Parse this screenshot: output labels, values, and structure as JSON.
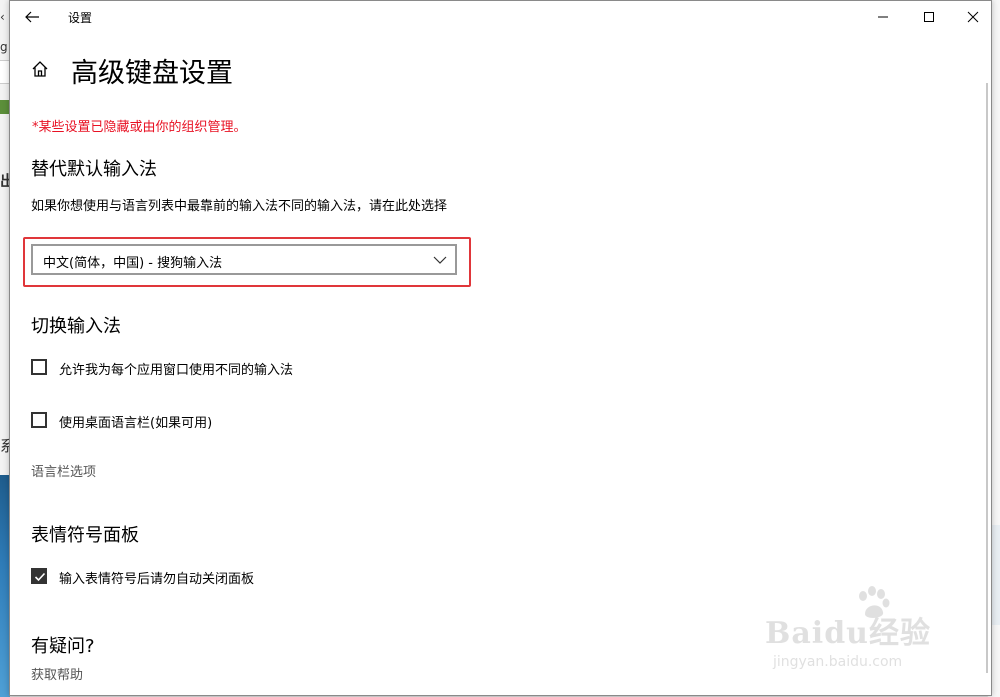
{
  "window": {
    "title": "设置",
    "page_title": "高级键盘设置"
  },
  "notice": "*某些设置已隐藏或由你的组织管理。",
  "override": {
    "title": "替代默认输入法",
    "description": "如果你想使用与语言列表中最靠前的输入法不同的输入法，请在此处选择",
    "selected": "中文(简体，中国) - 搜狗输入法"
  },
  "switch": {
    "title": "切换输入法",
    "option1": {
      "label": "允许我为每个应用窗口使用不同的输入法",
      "checked": false
    },
    "option2": {
      "label": "使用桌面语言栏(如果可用)",
      "checked": false
    },
    "language_bar_link": "语言栏选项"
  },
  "emoji": {
    "title": "表情符号面板",
    "option": {
      "label": "输入表情符号后请勿自动关闭面板",
      "checked": true
    }
  },
  "help": {
    "title": "有疑问?",
    "link": "获取帮助"
  },
  "watermark": {
    "brand": "Baidu经验",
    "url": "jingyan.baidu.com"
  },
  "background_fragments": [
    "g",
    "出",
    "系"
  ],
  "colors": {
    "notice": "#e81123",
    "highlight_box": "#e0363a"
  }
}
